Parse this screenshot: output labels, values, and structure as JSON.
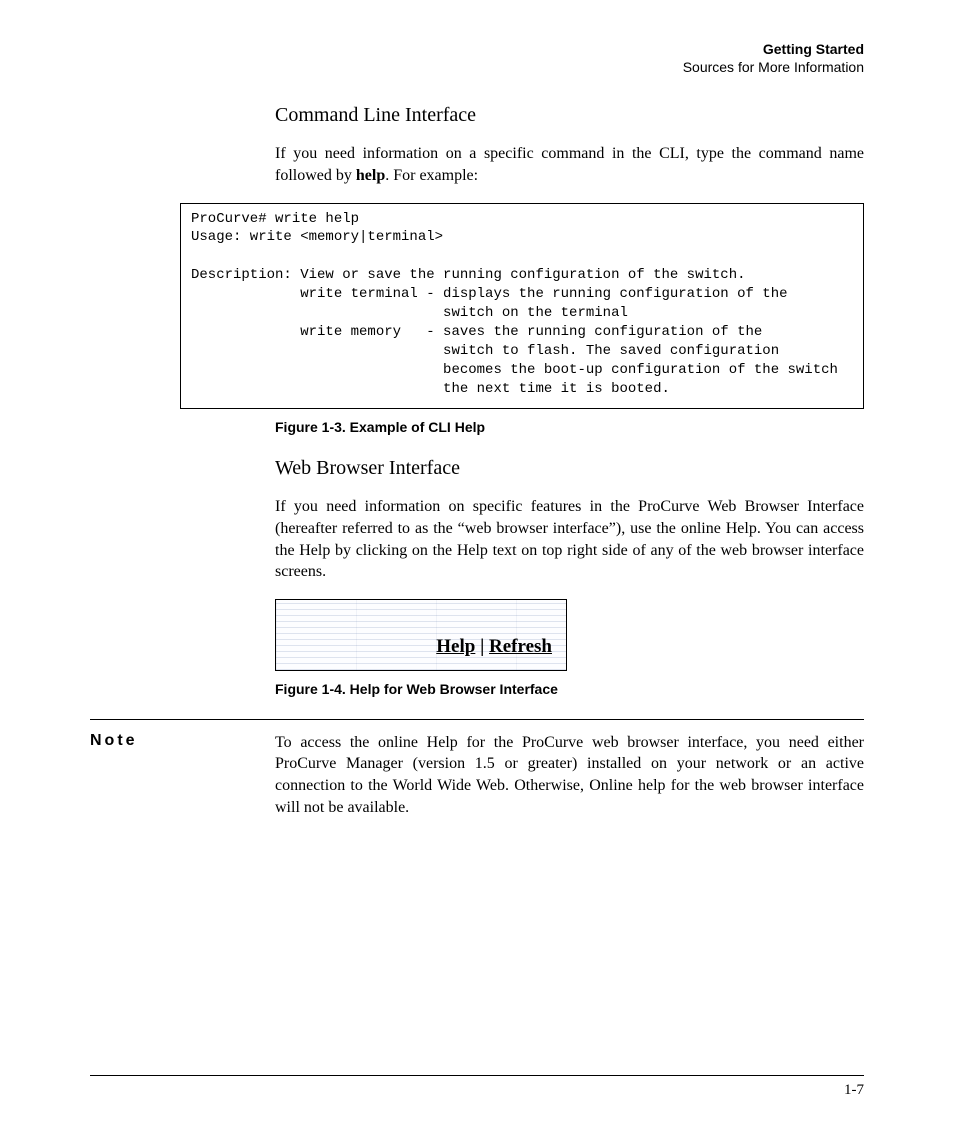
{
  "header": {
    "title": "Getting Started",
    "subtitle": "Sources for More Information"
  },
  "section1": {
    "heading": "Command Line Interface",
    "para_pre": "If you need information on a specific command in the CLI, type the command name followed by ",
    "para_bold": "help",
    "para_post": ". For example:"
  },
  "cli_text": "ProCurve# write help\nUsage: write <memory|terminal>\n\nDescription: View or save the running configuration of the switch.\n             write terminal - displays the running configuration of the\n                              switch on the terminal\n             write memory   - saves the running configuration of the\n                              switch to flash. The saved configuration\n                              becomes the boot-up configuration of the switch\n                              the next time it is booted.",
  "fig1_caption": "Figure 1-3.   Example of CLI Help",
  "section2": {
    "heading": "Web Browser Interface",
    "para": "If you need information on specific features in the ProCurve Web Browser Interface (hereafter referred to as the “web browser interface”), use the online Help. You can access the Help by clicking on the Help text on top right side of any of the web browser interface screens."
  },
  "screenshot": {
    "help": "Help",
    "sep": " | ",
    "refresh": "Refresh"
  },
  "fig2_caption": "Figure 1-4.   Help for Web Browser Interface",
  "note": {
    "label": "Note",
    "body": "To access the online Help for the ProCurve web browser interface, you need either ProCurve Manager (version 1.5 or greater) installed on your network or an active connection to the World Wide Web. Otherwise, Online help for the web browser interface will not be available."
  },
  "page_number": "1-7"
}
